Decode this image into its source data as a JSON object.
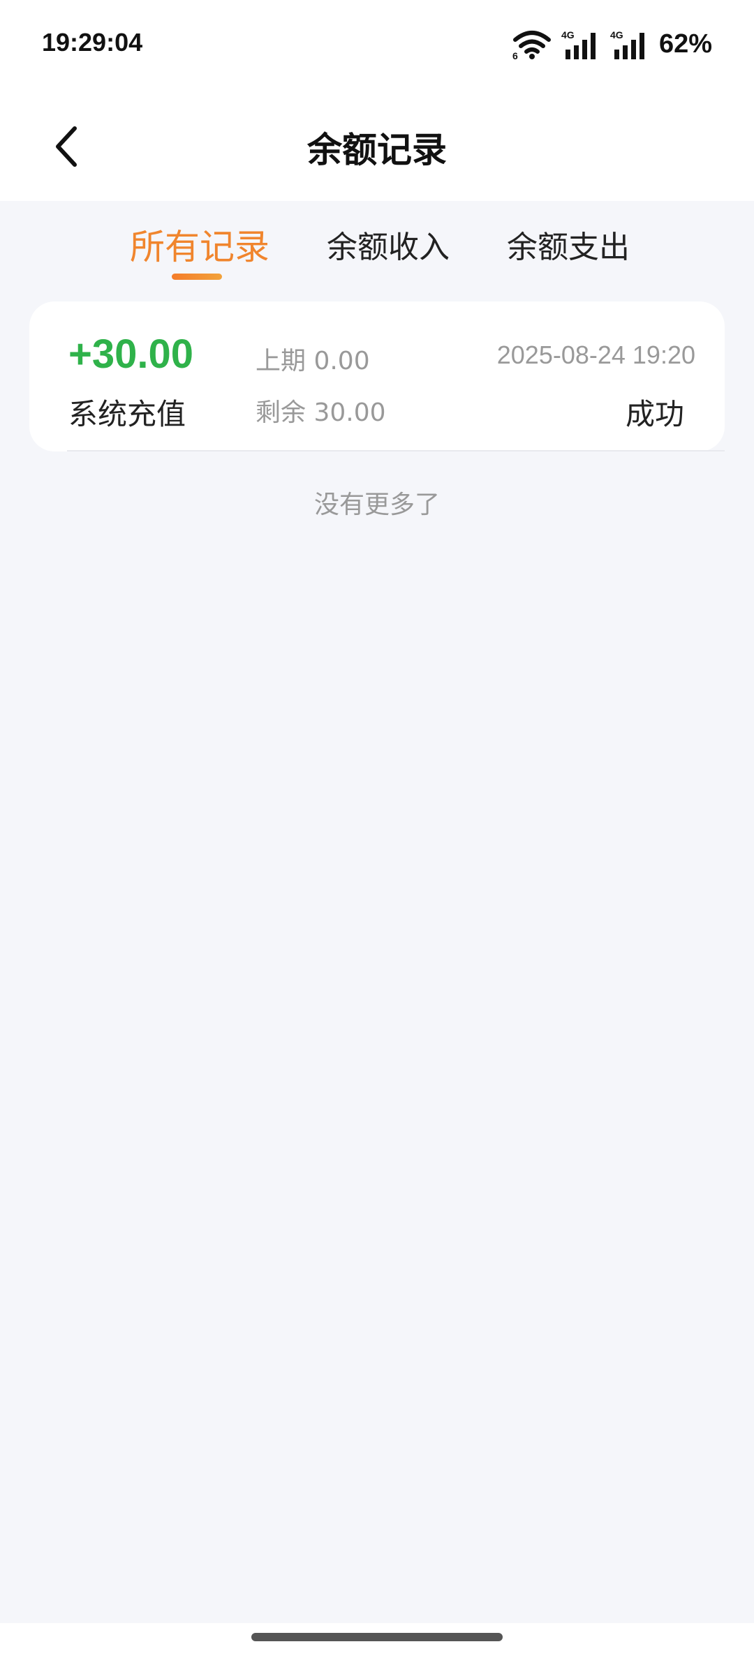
{
  "status_bar": {
    "time": "19:29:04",
    "battery": "62%",
    "icons": [
      "wifi-icon",
      "signal-4g-icon",
      "signal-4g-icon"
    ]
  },
  "header": {
    "title": "余额记录",
    "back_icon": "chevron-left-icon"
  },
  "tabs": [
    {
      "label": "所有记录",
      "active": true
    },
    {
      "label": "余额收入",
      "active": false
    },
    {
      "label": "余额支出",
      "active": false
    }
  ],
  "records": [
    {
      "amount": "+30.00",
      "type": "系统充值",
      "prev_balance": "上期 0.00",
      "remaining": "剩余 30.00",
      "time": "2025-08-24 19:20",
      "status": "成功"
    }
  ],
  "footer_text": "没有更多了",
  "colors": {
    "accent": "#f0852d",
    "positive": "#2fb24a",
    "background": "#f5f6fa"
  }
}
